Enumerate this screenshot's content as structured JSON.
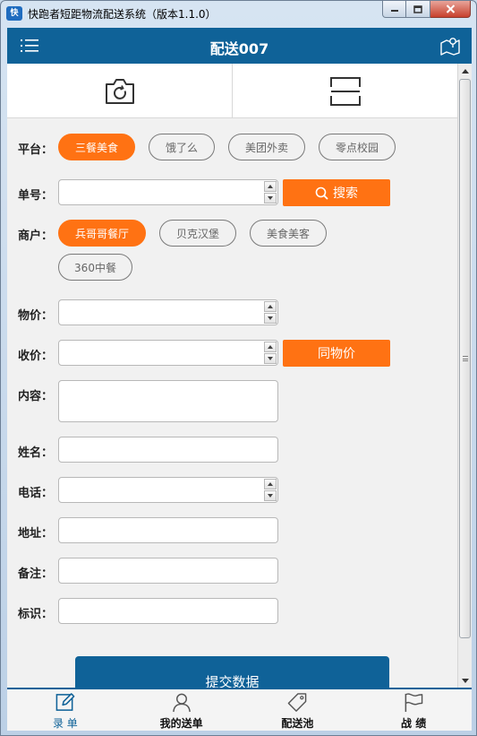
{
  "window": {
    "title": "快跑者短距物流配送系统（版本1.1.0）",
    "icon_text": "快"
  },
  "header": {
    "title": "配送007"
  },
  "form": {
    "platform": {
      "label": "平台：",
      "options": [
        "三餐美食",
        "饿了么",
        "美团外卖",
        "零点校园"
      ],
      "selected": "三餐美食"
    },
    "order_no": {
      "label": "单号：",
      "value": "",
      "search_label": "搜索"
    },
    "merchant": {
      "label": "商户：",
      "options": [
        "兵哥哥餐厅",
        "贝克汉堡",
        "美食美客",
        "360中餐"
      ],
      "selected": "兵哥哥餐厅"
    },
    "price": {
      "label": "物价：",
      "value": ""
    },
    "charge": {
      "label": "收价：",
      "value": "",
      "same_label": "同物价"
    },
    "content": {
      "label": "内容：",
      "value": ""
    },
    "name": {
      "label": "姓名：",
      "value": ""
    },
    "phone": {
      "label": "电话：",
      "value": ""
    },
    "address": {
      "label": "地址：",
      "value": ""
    },
    "note": {
      "label": "备注：",
      "value": ""
    },
    "mark": {
      "label": "标识：",
      "value": ""
    },
    "submit_label": "提交数据"
  },
  "bottom_nav": {
    "items": [
      "录 单",
      "我的送单",
      "配送池",
      "战 绩"
    ],
    "active": "录 单"
  },
  "colors": {
    "primary": "#0f6298",
    "accent": "#ff7213"
  }
}
